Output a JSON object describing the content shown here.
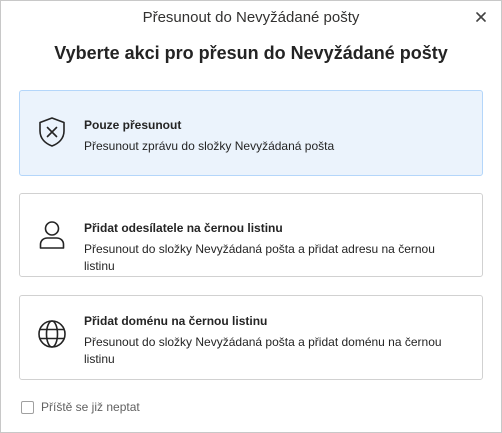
{
  "dialog": {
    "title": "Přesunout do Nevyžádané pošty",
    "heading": "Vyberte akci pro přesun do Nevyžádané pošty",
    "close_icon": "close-icon"
  },
  "options": [
    {
      "icon": "shield-x-icon",
      "title": "Pouze přesunout",
      "description": "Přesunout zprávu do složky Nevyžádaná pošta",
      "selected": true
    },
    {
      "icon": "person-icon",
      "title": "Přidat odesílatele na černou listinu",
      "description": "Přesunout do složky Nevyžádaná pošta a přidat adresu na černou listinu",
      "selected": false
    },
    {
      "icon": "globe-icon",
      "title": "Přidat doménu na černou listinu",
      "description": "Přesunout do složky Nevyžádaná pošta a přidat doménu na černou listinu",
      "selected": false
    }
  ],
  "footer": {
    "checkbox_label": "Příště se již neptat",
    "checked": false
  },
  "colors": {
    "selected_background": "#ebf3fc",
    "selected_border": "#b4d6fa"
  }
}
